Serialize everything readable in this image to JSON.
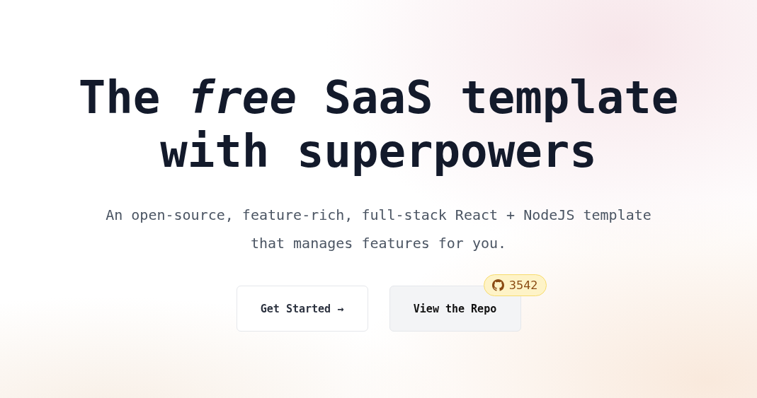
{
  "hero": {
    "title": "The *free* SaaS template with superpowers",
    "subtitle": "An open-source, feature-rich, full-stack React + NodeJS template that manages features for you.",
    "buttons": [
      {
        "label": "Get Started →",
        "kind": "outline"
      },
      {
        "label": "View the Repo",
        "kind": "filled",
        "badge": "3542"
      }
    ]
  }
}
